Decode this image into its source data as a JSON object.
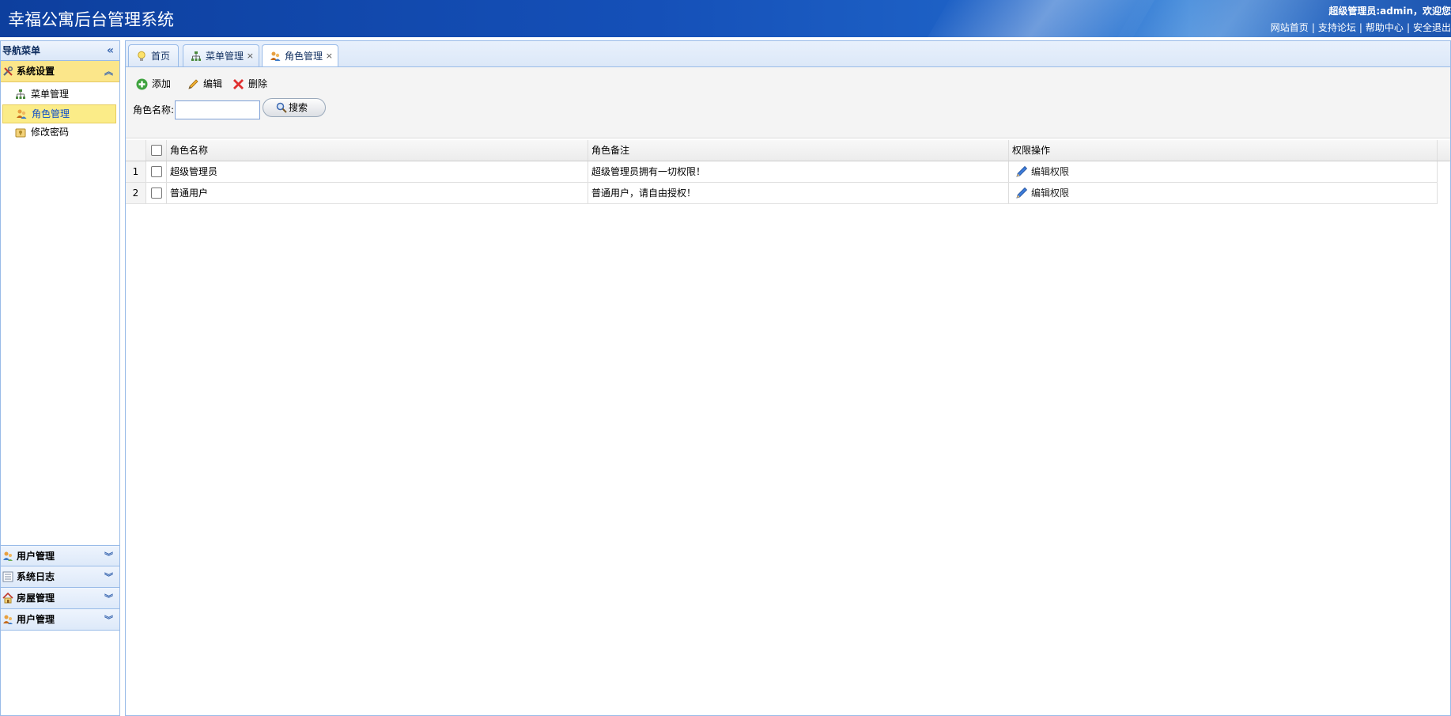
{
  "header": {
    "title": "幸福公寓后台管理系统",
    "welcome": "超级管理员:admin，欢迎您",
    "links": [
      "网站首页",
      "支持论坛",
      "帮助中心",
      "安全退出"
    ]
  },
  "sidebar": {
    "title": "导航菜单",
    "active_section": {
      "label": "系统设置",
      "items": [
        {
          "label": "菜单管理",
          "icon": "sitemap-icon"
        },
        {
          "label": "角色管理",
          "icon": "role-icon"
        },
        {
          "label": "修改密码",
          "icon": "password-icon"
        }
      ]
    },
    "collapsed_sections": [
      {
        "label": "用户管理",
        "icon": "users-icon"
      },
      {
        "label": "系统日志",
        "icon": "log-icon"
      },
      {
        "label": "房屋管理",
        "icon": "house-icon"
      },
      {
        "label": "用户管理",
        "icon": "users-icon"
      }
    ]
  },
  "tabs": [
    {
      "label": "首页",
      "icon": "lightbulb-icon",
      "closable": false
    },
    {
      "label": "菜单管理",
      "icon": "sitemap-icon",
      "closable": true
    },
    {
      "label": "角色管理",
      "icon": "role-icon",
      "closable": true,
      "active": true
    }
  ],
  "toolbar": {
    "add_label": "添加",
    "edit_label": "编辑",
    "delete_label": "删除",
    "search_label": "角色名称:",
    "search_value": "",
    "search_button": "搜索"
  },
  "grid": {
    "columns": [
      "角色名称",
      "角色备注",
      "权限操作"
    ],
    "rows": [
      {
        "num": "1",
        "name": "超级管理员",
        "note": "超级管理员拥有一切权限！",
        "op": "编辑权限"
      },
      {
        "num": "2",
        "name": "普通用户",
        "note": "普通用户，请自由授权！",
        "op": "编辑权限"
      }
    ]
  },
  "colors": {
    "header_blue": "#1550b8",
    "border_blue": "#99bbe8",
    "active_yellow": "#fbe68a"
  }
}
